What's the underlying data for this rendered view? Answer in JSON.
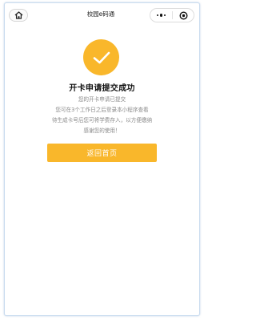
{
  "app": {
    "title": "校园e码通"
  },
  "navbar": {
    "home_icon": "home-icon",
    "more_icon": "more-dots-icon",
    "close_icon": "target-close-icon"
  },
  "result": {
    "status_icon": "check-icon",
    "accent_color": "#f9b72b",
    "title": "开卡申请提交成功",
    "messages": [
      "您的开卡申请已提交",
      "您可在3个工作日之后登录本小程序查看",
      "待生成卡号后您可将学费存入，以方便缴纳",
      "感谢您的使用！"
    ],
    "back_button_label": "返回首页"
  }
}
